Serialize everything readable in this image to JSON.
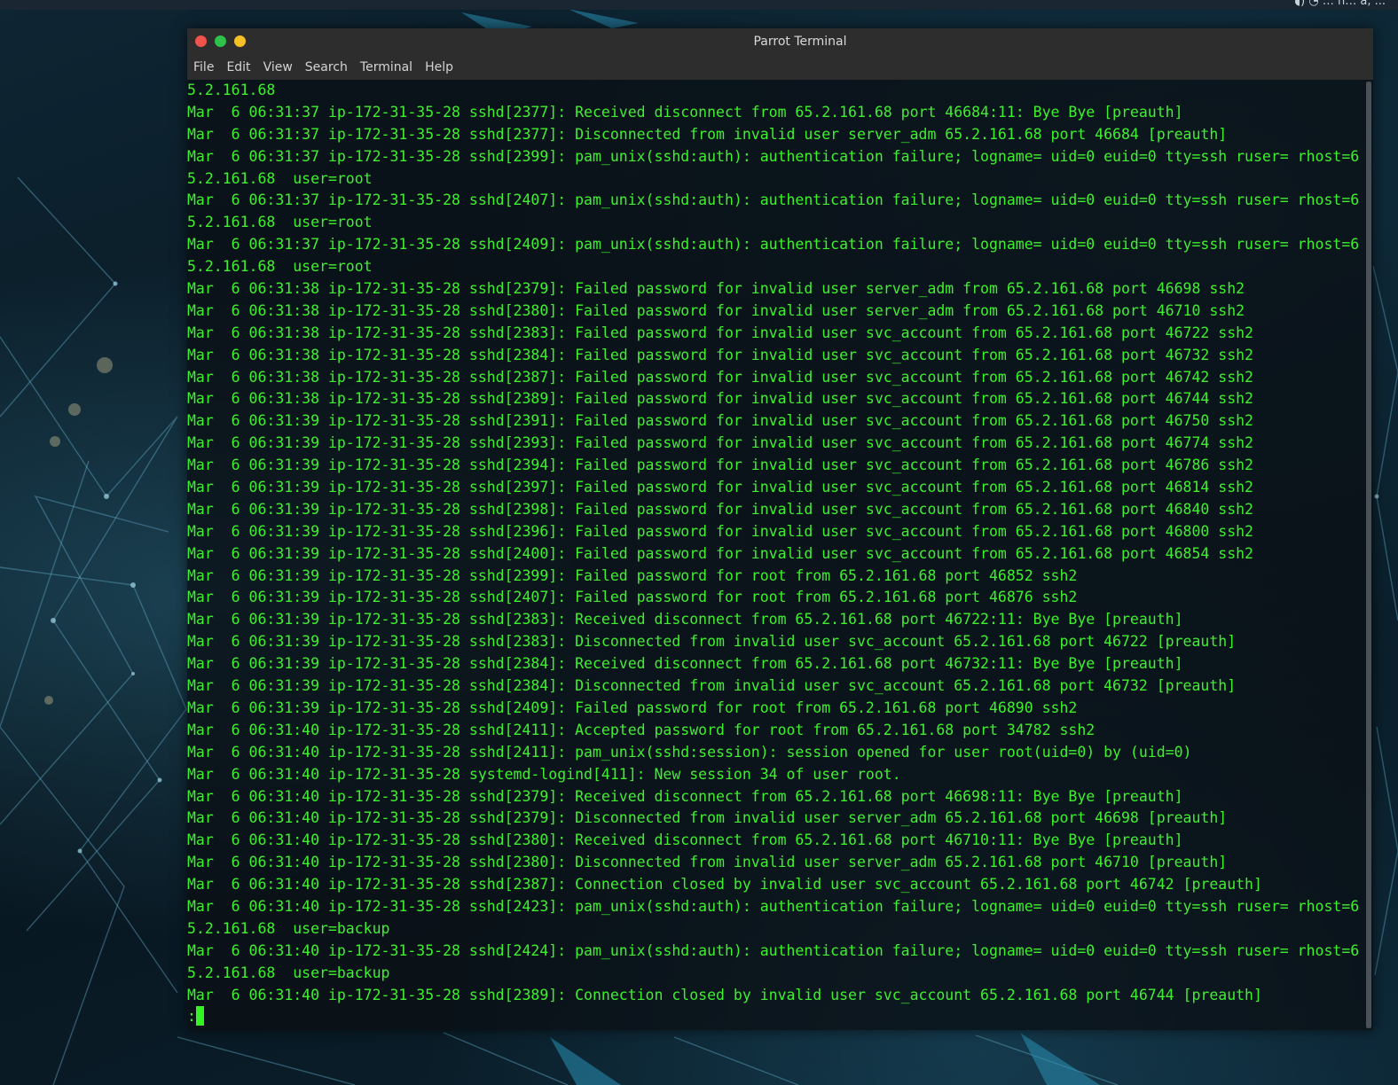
{
  "topbar": {
    "tray_text": "◖) ◔  … n… a, ..."
  },
  "window": {
    "title": "Parrot Terminal"
  },
  "menu": {
    "items": [
      "File",
      "Edit",
      "View",
      "Search",
      "Terminal",
      "Help"
    ]
  },
  "terminal": {
    "text_color": "#3ef02e",
    "lines": [
      "5.2.161.68",
      "Mar  6 06:31:37 ip-172-31-35-28 sshd[2377]: Received disconnect from 65.2.161.68 port 46684:11: Bye Bye [preauth]",
      "Mar  6 06:31:37 ip-172-31-35-28 sshd[2377]: Disconnected from invalid user server_adm 65.2.161.68 port 46684 [preauth]",
      "Mar  6 06:31:37 ip-172-31-35-28 sshd[2399]: pam_unix(sshd:auth): authentication failure; logname= uid=0 euid=0 tty=ssh ruser= rhost=6",
      "5.2.161.68  user=root",
      "Mar  6 06:31:37 ip-172-31-35-28 sshd[2407]: pam_unix(sshd:auth): authentication failure; logname= uid=0 euid=0 tty=ssh ruser= rhost=6",
      "5.2.161.68  user=root",
      "Mar  6 06:31:37 ip-172-31-35-28 sshd[2409]: pam_unix(sshd:auth): authentication failure; logname= uid=0 euid=0 tty=ssh ruser= rhost=6",
      "5.2.161.68  user=root",
      "Mar  6 06:31:38 ip-172-31-35-28 sshd[2379]: Failed password for invalid user server_adm from 65.2.161.68 port 46698 ssh2",
      "Mar  6 06:31:38 ip-172-31-35-28 sshd[2380]: Failed password for invalid user server_adm from 65.2.161.68 port 46710 ssh2",
      "Mar  6 06:31:38 ip-172-31-35-28 sshd[2383]: Failed password for invalid user svc_account from 65.2.161.68 port 46722 ssh2",
      "Mar  6 06:31:38 ip-172-31-35-28 sshd[2384]: Failed password for invalid user svc_account from 65.2.161.68 port 46732 ssh2",
      "Mar  6 06:31:38 ip-172-31-35-28 sshd[2387]: Failed password for invalid user svc_account from 65.2.161.68 port 46742 ssh2",
      "Mar  6 06:31:38 ip-172-31-35-28 sshd[2389]: Failed password for invalid user svc_account from 65.2.161.68 port 46744 ssh2",
      "Mar  6 06:31:39 ip-172-31-35-28 sshd[2391]: Failed password for invalid user svc_account from 65.2.161.68 port 46750 ssh2",
      "Mar  6 06:31:39 ip-172-31-35-28 sshd[2393]: Failed password for invalid user svc_account from 65.2.161.68 port 46774 ssh2",
      "Mar  6 06:31:39 ip-172-31-35-28 sshd[2394]: Failed password for invalid user svc_account from 65.2.161.68 port 46786 ssh2",
      "Mar  6 06:31:39 ip-172-31-35-28 sshd[2397]: Failed password for invalid user svc_account from 65.2.161.68 port 46814 ssh2",
      "Mar  6 06:31:39 ip-172-31-35-28 sshd[2398]: Failed password for invalid user svc_account from 65.2.161.68 port 46840 ssh2",
      "Mar  6 06:31:39 ip-172-31-35-28 sshd[2396]: Failed password for invalid user svc_account from 65.2.161.68 port 46800 ssh2",
      "Mar  6 06:31:39 ip-172-31-35-28 sshd[2400]: Failed password for invalid user svc_account from 65.2.161.68 port 46854 ssh2",
      "Mar  6 06:31:39 ip-172-31-35-28 sshd[2399]: Failed password for root from 65.2.161.68 port 46852 ssh2",
      "Mar  6 06:31:39 ip-172-31-35-28 sshd[2407]: Failed password for root from 65.2.161.68 port 46876 ssh2",
      "Mar  6 06:31:39 ip-172-31-35-28 sshd[2383]: Received disconnect from 65.2.161.68 port 46722:11: Bye Bye [preauth]",
      "Mar  6 06:31:39 ip-172-31-35-28 sshd[2383]: Disconnected from invalid user svc_account 65.2.161.68 port 46722 [preauth]",
      "Mar  6 06:31:39 ip-172-31-35-28 sshd[2384]: Received disconnect from 65.2.161.68 port 46732:11: Bye Bye [preauth]",
      "Mar  6 06:31:39 ip-172-31-35-28 sshd[2384]: Disconnected from invalid user svc_account 65.2.161.68 port 46732 [preauth]",
      "Mar  6 06:31:39 ip-172-31-35-28 sshd[2409]: Failed password for root from 65.2.161.68 port 46890 ssh2",
      "Mar  6 06:31:40 ip-172-31-35-28 sshd[2411]: Accepted password for root from 65.2.161.68 port 34782 ssh2",
      "Mar  6 06:31:40 ip-172-31-35-28 sshd[2411]: pam_unix(sshd:session): session opened for user root(uid=0) by (uid=0)",
      "Mar  6 06:31:40 ip-172-31-35-28 systemd-logind[411]: New session 34 of user root.",
      "Mar  6 06:31:40 ip-172-31-35-28 sshd[2379]: Received disconnect from 65.2.161.68 port 46698:11: Bye Bye [preauth]",
      "Mar  6 06:31:40 ip-172-31-35-28 sshd[2379]: Disconnected from invalid user server_adm 65.2.161.68 port 46698 [preauth]",
      "Mar  6 06:31:40 ip-172-31-35-28 sshd[2380]: Received disconnect from 65.2.161.68 port 46710:11: Bye Bye [preauth]",
      "Mar  6 06:31:40 ip-172-31-35-28 sshd[2380]: Disconnected from invalid user server_adm 65.2.161.68 port 46710 [preauth]",
      "Mar  6 06:31:40 ip-172-31-35-28 sshd[2387]: Connection closed by invalid user svc_account 65.2.161.68 port 46742 [preauth]",
      "Mar  6 06:31:40 ip-172-31-35-28 sshd[2423]: pam_unix(sshd:auth): authentication failure; logname= uid=0 euid=0 tty=ssh ruser= rhost=6",
      "5.2.161.68  user=backup",
      "Mar  6 06:31:40 ip-172-31-35-28 sshd[2424]: pam_unix(sshd:auth): authentication failure; logname= uid=0 euid=0 tty=ssh ruser= rhost=6",
      "5.2.161.68  user=backup",
      "Mar  6 06:31:40 ip-172-31-35-28 sshd[2389]: Connection closed by invalid user svc_account 65.2.161.68 port 46744 [preauth]"
    ],
    "prompt": ":"
  }
}
